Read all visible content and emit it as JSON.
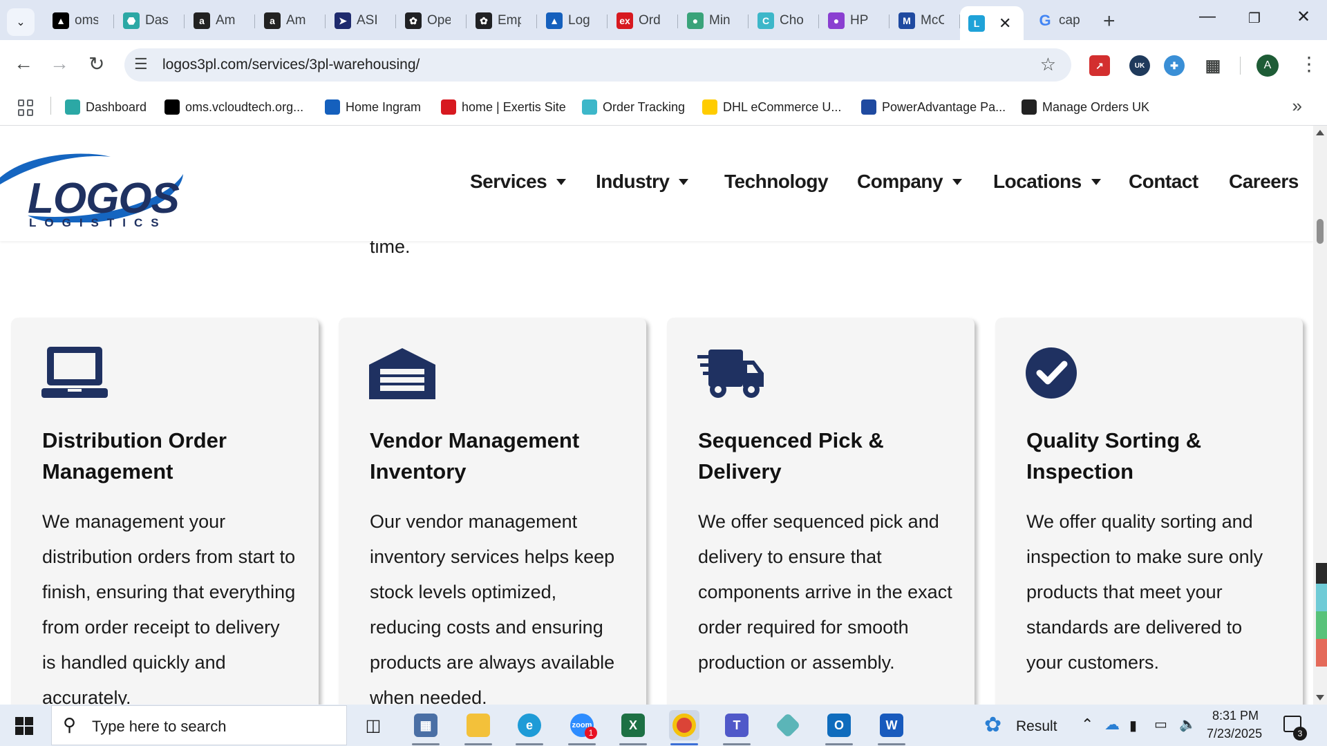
{
  "browser": {
    "tabs": [
      {
        "label": "oms",
        "icon": "triangle-logo-icon",
        "color": "#000000"
      },
      {
        "label": "Das",
        "icon": "hexagon-logo-icon",
        "color": "#2ba8a5"
      },
      {
        "label": "Am",
        "icon": "amazon-icon",
        "color": "#222222"
      },
      {
        "label": "Am",
        "icon": "amazon-icon",
        "color": "#222222"
      },
      {
        "label": "ASI",
        "icon": "play-arrow-icon",
        "color": "#1e2a6e"
      },
      {
        "label": "Ope",
        "icon": "openai-icon",
        "color": "#202124"
      },
      {
        "label": "Emp",
        "icon": "openai-icon",
        "color": "#202124"
      },
      {
        "label": "Log",
        "icon": "ingram-icon",
        "color": "#1560bd"
      },
      {
        "label": "Ord",
        "icon": "exertis-icon",
        "color": "#d71920"
      },
      {
        "label": "Min",
        "icon": "mint-icon",
        "color": "#3aa37a"
      },
      {
        "label": "Cho",
        "icon": "c-logo-icon",
        "color": "#3db7c9"
      },
      {
        "label": "HP",
        "icon": "hp-icon",
        "color": "#8a3fd1"
      },
      {
        "label": "McC",
        "icon": "m-logo-icon",
        "color": "#1f4aa0"
      }
    ],
    "active_tab": {
      "label": "L",
      "close": "✕"
    },
    "after_tab": {
      "label": "cap",
      "icon": "google-icon"
    },
    "new_tab": "+",
    "url": "logos3pl.com/services/3pl-warehousing/",
    "bookmarks": [
      {
        "label": "Dashboard",
        "icon": "hexagon-logo-icon",
        "color": "#2ba8a5"
      },
      {
        "label": "oms.vcloudtech.org...",
        "icon": "triangle-logo-icon",
        "color": "#000000"
      },
      {
        "label": "Home Ingram",
        "icon": "ingram-icon",
        "color": "#1560bd"
      },
      {
        "label": "home | Exertis Site",
        "icon": "exertis-icon",
        "color": "#d71920"
      },
      {
        "label": "Order Tracking",
        "icon": "c-logo-icon",
        "color": "#3db7c9"
      },
      {
        "label": "DHL eCommerce U...",
        "icon": "dhl-icon",
        "color": "#ffcc00"
      },
      {
        "label": "PowerAdvantage Pa...",
        "icon": "poweradvantage-icon",
        "color": "#1f4aa0"
      },
      {
        "label": "Manage Orders UK",
        "icon": "amazon-icon",
        "color": "#222222"
      }
    ],
    "profile_initial": "A",
    "extension_badge": "UK"
  },
  "site": {
    "logo": {
      "main": "LOGOS",
      "sub": "LOGISTICS"
    },
    "nav": [
      {
        "label": "Services",
        "dropdown": true
      },
      {
        "label": "Industry",
        "dropdown": true
      },
      {
        "label": "Technology",
        "dropdown": false
      },
      {
        "label": "Company",
        "dropdown": true
      },
      {
        "label": "Locations",
        "dropdown": true
      },
      {
        "label": "Contact",
        "dropdown": false
      },
      {
        "label": "Careers",
        "dropdown": false
      }
    ],
    "partial_text": "time.",
    "cards": [
      {
        "icon": "laptop-icon",
        "title": "Distribution Order Management",
        "body": "We management your distribution orders from start to finish, ensuring that everything from order receipt to delivery is handled quickly and accurately."
      },
      {
        "icon": "warehouse-icon",
        "title": "Vendor Management Inventory",
        "body": "Our vendor management inventory services helps keep stock levels optimized, reducing costs and ensuring products are always available when needed."
      },
      {
        "icon": "delivery-truck-icon",
        "title": "Sequenced Pick & Delivery",
        "body": "We offer sequenced pick and delivery to ensure that components arrive in the exact order required for smooth production or assembly."
      },
      {
        "icon": "check-circle-icon",
        "title": "Quality Sorting & Inspection",
        "body": "We offer quality sorting and inspection to make sure only products that meet your standards are delivered to your customers."
      }
    ],
    "brand_color": "#1f3161"
  },
  "taskbar": {
    "search_placeholder": "Type here to search",
    "weather_label": "Result",
    "time": "8:31 PM",
    "date": "7/23/2025",
    "notification_count": "3",
    "zoom_badge": "1"
  }
}
